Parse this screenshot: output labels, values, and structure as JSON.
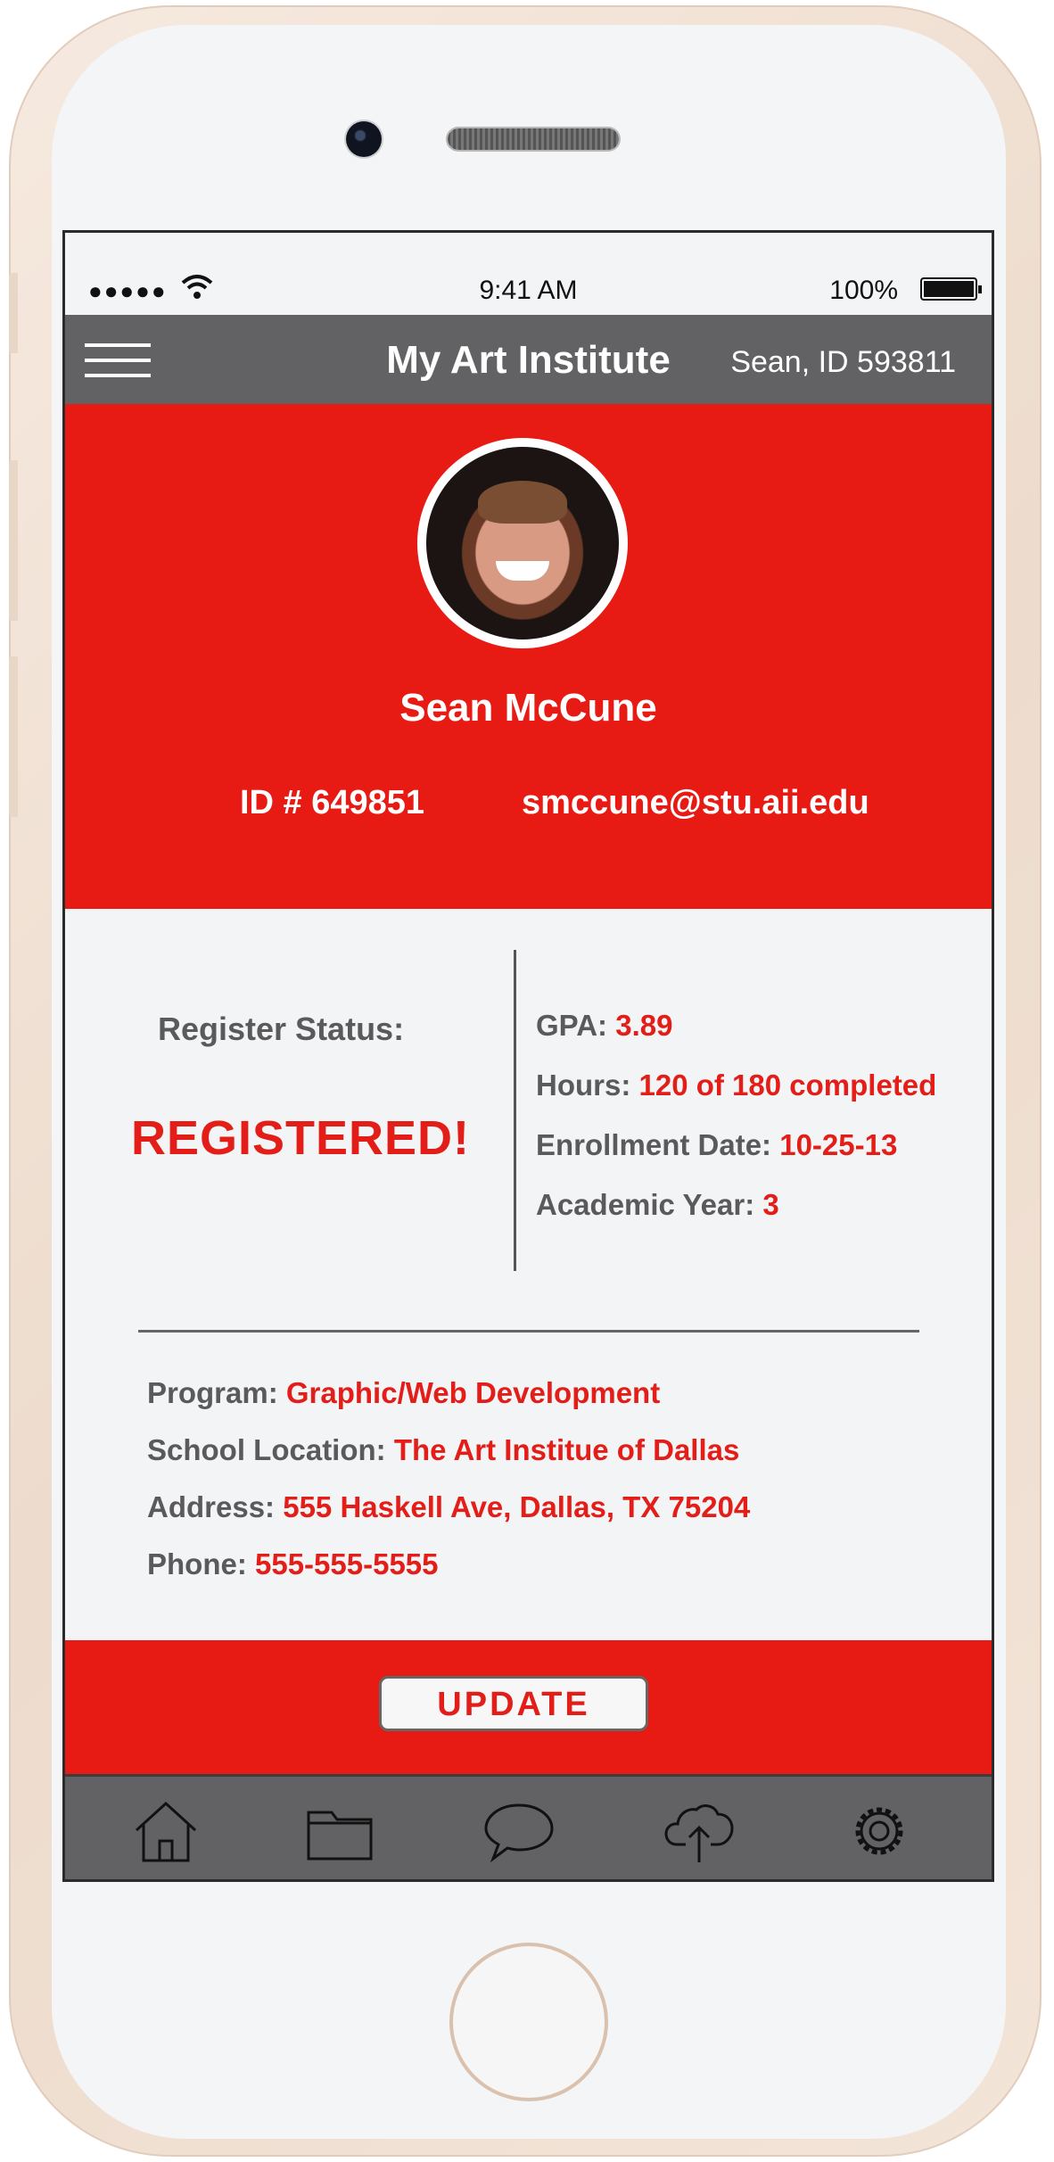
{
  "status_bar": {
    "signal": "●●●●●",
    "time": "9:41 AM",
    "battery": "100%"
  },
  "app_bar": {
    "title": "My Art Institute",
    "user": "Sean, ID 593811"
  },
  "profile": {
    "name": "Sean McCune",
    "student_id": "ID # 649851",
    "email": "smccune@stu.aii.edu"
  },
  "registration": {
    "label": "Register Status:",
    "value": "REGISTERED!"
  },
  "stats": [
    {
      "label": "GPA:",
      "value": "3.89"
    },
    {
      "label": "Hours:",
      "value": "120 of 180 completed"
    },
    {
      "label": "Enrollment Date:",
      "value": "10-25-13"
    },
    {
      "label": "Academic Year:",
      "value": "3"
    }
  ],
  "info": [
    {
      "label": "Program:",
      "value": "Graphic/Web Development"
    },
    {
      "label": "School Location:",
      "value": "The Art Institue of Dallas"
    },
    {
      "label": "Address:",
      "value": "555 Haskell Ave, Dallas, TX 75204"
    },
    {
      "label": "Phone:",
      "value": "555-555-5555"
    }
  ],
  "update_label": "UPDATE",
  "tabs": [
    "home-icon",
    "folder-icon",
    "chat-icon",
    "cloud-upload-icon",
    "gear-icon"
  ],
  "colors": {
    "accent": "#e81b14",
    "bar": "#626264",
    "text_gray": "#5a5a5c"
  }
}
